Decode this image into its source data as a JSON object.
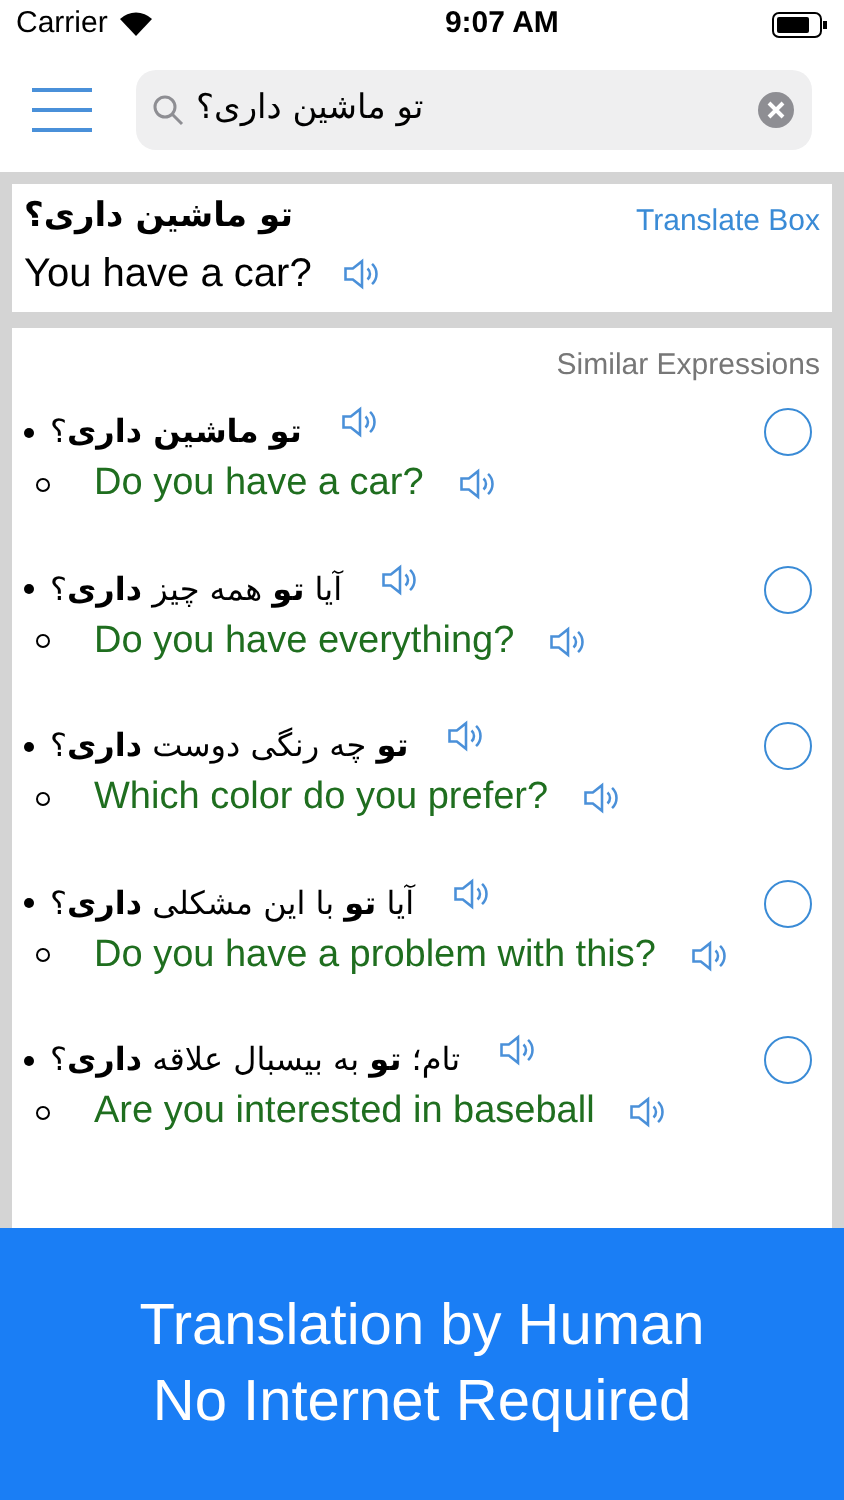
{
  "status_bar": {
    "carrier": "Carrier",
    "time": "9:07 AM"
  },
  "search": {
    "value": "تو ماشین داری؟"
  },
  "translate_box": {
    "source": "تو ماشین داری؟",
    "translation": "You have a car?",
    "link": "Translate Box"
  },
  "similar": {
    "title": "Similar Expressions",
    "items": [
      {
        "persian": "**تو ماشین داری**؟",
        "english": "Do you have a car?",
        "selected": false
      },
      {
        "persian": "آیا **تو** همه چیز **داری**؟",
        "english": "Do you have everything?",
        "selected": false
      },
      {
        "persian": "**تو** چه رنگی دوست **داری**؟",
        "english": "Which color do you prefer?",
        "selected": false
      },
      {
        "persian": "آیا **تو** با این مشکلی **داری**؟",
        "english": "Do you have a problem with this?",
        "selected": false
      },
      {
        "persian": "تام؛ **تو** به بیسبال علاقه **داری**؟",
        "english": "Are you interested in baseball",
        "selected": false
      }
    ]
  },
  "banner": {
    "lines": [
      "Translation by Human",
      "No Internet Required"
    ]
  }
}
